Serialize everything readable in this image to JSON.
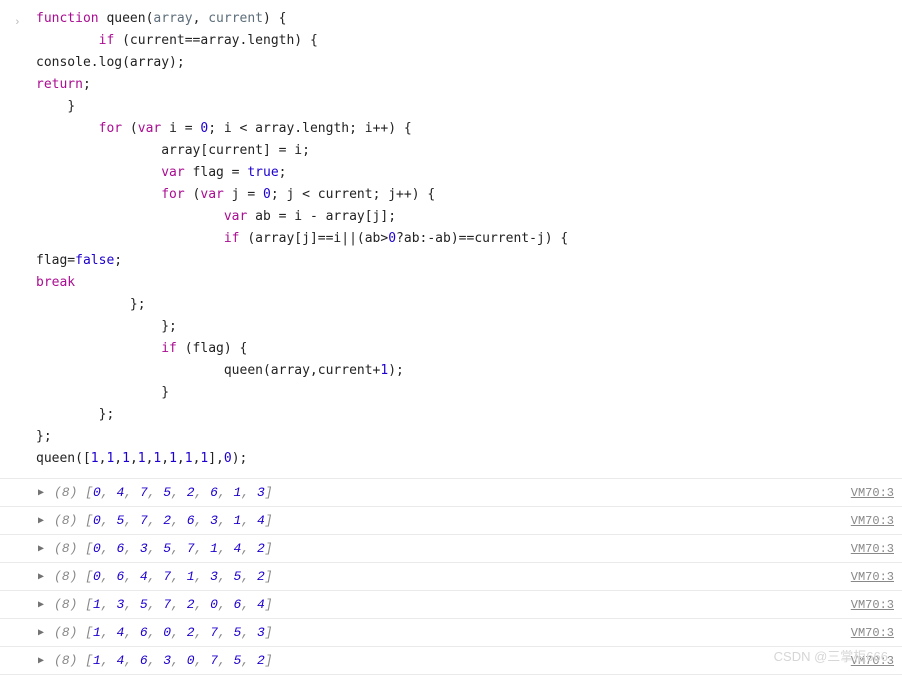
{
  "code": {
    "lines": [
      {
        "indent": 0,
        "tokens": [
          [
            "kw",
            "function"
          ],
          [
            "sp",
            " "
          ],
          [
            "fn",
            "queen"
          ],
          [
            "op",
            "("
          ],
          [
            "param",
            "array"
          ],
          [
            "op",
            ", "
          ],
          [
            "param",
            "current"
          ],
          [
            "op",
            ") {"
          ]
        ]
      },
      {
        "indent": 2,
        "tokens": [
          [
            "kw",
            "if"
          ],
          [
            "op",
            " (current==array.length) {"
          ]
        ]
      },
      {
        "indent": 0,
        "tokens": [
          [
            "op",
            "console.log(array);"
          ]
        ]
      },
      {
        "indent": 0,
        "tokens": [
          [
            "kw",
            "return"
          ],
          [
            "op",
            ";"
          ]
        ]
      },
      {
        "indent": 1,
        "tokens": [
          [
            "op",
            "}"
          ]
        ]
      },
      {
        "indent": 2,
        "tokens": [
          [
            "kw",
            "for"
          ],
          [
            "op",
            " ("
          ],
          [
            "kw",
            "var"
          ],
          [
            "op",
            " i = "
          ],
          [
            "num",
            "0"
          ],
          [
            "op",
            "; i < array.length; i++) {"
          ]
        ]
      },
      {
        "indent": 4,
        "tokens": [
          [
            "op",
            "array[current] = i;"
          ]
        ]
      },
      {
        "indent": 4,
        "tokens": [
          [
            "kw",
            "var"
          ],
          [
            "op",
            " flag = "
          ],
          [
            "bool",
            "true"
          ],
          [
            "op",
            ";"
          ]
        ]
      },
      {
        "indent": 4,
        "tokens": [
          [
            "kw",
            "for"
          ],
          [
            "op",
            " ("
          ],
          [
            "kw",
            "var"
          ],
          [
            "op",
            " j = "
          ],
          [
            "num",
            "0"
          ],
          [
            "op",
            "; j < current; j++) {"
          ]
        ]
      },
      {
        "indent": 6,
        "tokens": [
          [
            "kw",
            "var"
          ],
          [
            "op",
            " ab = i - array[j];"
          ]
        ]
      },
      {
        "indent": 6,
        "tokens": [
          [
            "kw",
            "if"
          ],
          [
            "op",
            " (array[j]==i||(ab>"
          ],
          [
            "num",
            "0"
          ],
          [
            "op",
            "?ab:-ab)==current-j) {"
          ]
        ]
      },
      {
        "indent": 0,
        "tokens": [
          [
            "op",
            "flag="
          ],
          [
            "bool",
            "false"
          ],
          [
            "op",
            ";"
          ]
        ]
      },
      {
        "indent": 0,
        "tokens": [
          [
            "kw",
            "break"
          ]
        ]
      },
      {
        "indent": 3,
        "tokens": [
          [
            "op",
            "};"
          ]
        ]
      },
      {
        "indent": 4,
        "tokens": [
          [
            "op",
            "};"
          ]
        ]
      },
      {
        "indent": 4,
        "tokens": [
          [
            "kw",
            "if"
          ],
          [
            "op",
            " (flag) {"
          ]
        ]
      },
      {
        "indent": 6,
        "tokens": [
          [
            "op",
            "queen(array,current+"
          ],
          [
            "num",
            "1"
          ],
          [
            "op",
            ");"
          ]
        ]
      },
      {
        "indent": 4,
        "tokens": [
          [
            "op",
            "}"
          ]
        ]
      },
      {
        "indent": 2,
        "tokens": [
          [
            "op",
            "};"
          ]
        ]
      },
      {
        "indent": 0,
        "tokens": [
          [
            "op",
            "};"
          ]
        ]
      },
      {
        "indent": 0,
        "tokens": [
          [
            "op",
            "queen(["
          ],
          [
            "num",
            "1"
          ],
          [
            "op",
            ","
          ],
          [
            "num",
            "1"
          ],
          [
            "op",
            ","
          ],
          [
            "num",
            "1"
          ],
          [
            "op",
            ","
          ],
          [
            "num",
            "1"
          ],
          [
            "op",
            ","
          ],
          [
            "num",
            "1"
          ],
          [
            "op",
            ","
          ],
          [
            "num",
            "1"
          ],
          [
            "op",
            ","
          ],
          [
            "num",
            "1"
          ],
          [
            "op",
            ","
          ],
          [
            "num",
            "1"
          ],
          [
            "op",
            "],"
          ],
          [
            "num",
            "0"
          ],
          [
            "op",
            ");"
          ]
        ]
      }
    ]
  },
  "outputs": [
    {
      "len": "(8)",
      "arr": [
        0,
        4,
        7,
        5,
        2,
        6,
        1,
        3
      ],
      "source": "VM70:3"
    },
    {
      "len": "(8)",
      "arr": [
        0,
        5,
        7,
        2,
        6,
        3,
        1,
        4
      ],
      "source": "VM70:3"
    },
    {
      "len": "(8)",
      "arr": [
        0,
        6,
        3,
        5,
        7,
        1,
        4,
        2
      ],
      "source": "VM70:3"
    },
    {
      "len": "(8)",
      "arr": [
        0,
        6,
        4,
        7,
        1,
        3,
        5,
        2
      ],
      "source": "VM70:3"
    },
    {
      "len": "(8)",
      "arr": [
        1,
        3,
        5,
        7,
        2,
        0,
        6,
        4
      ],
      "source": "VM70:3"
    },
    {
      "len": "(8)",
      "arr": [
        1,
        4,
        6,
        0,
        2,
        7,
        5,
        3
      ],
      "source": "VM70:3"
    },
    {
      "len": "(8)",
      "arr": [
        1,
        4,
        6,
        3,
        0,
        7,
        5,
        2
      ],
      "source": "VM70:3"
    }
  ],
  "watermark": "CSDN @三掌柜666",
  "gutter_icon": "›"
}
